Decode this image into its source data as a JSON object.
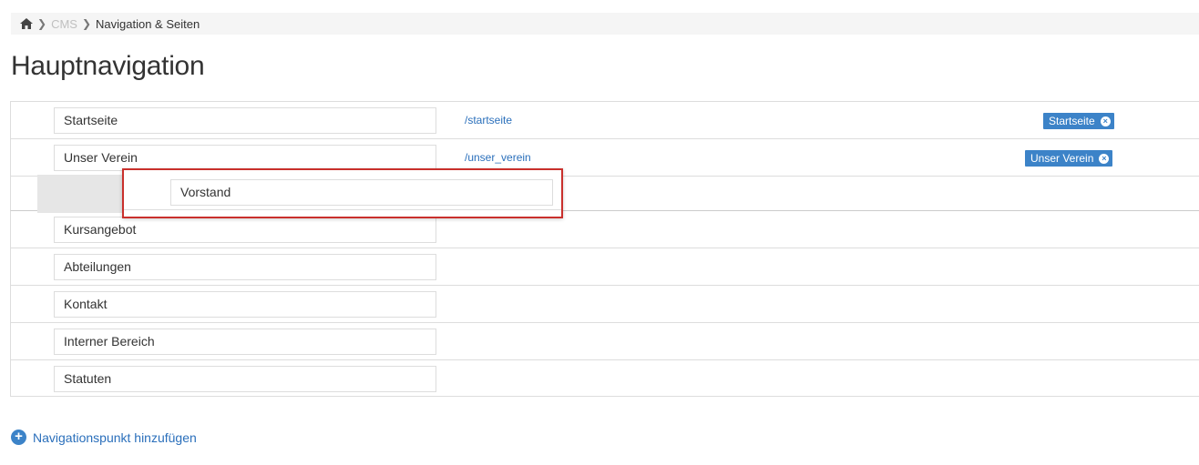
{
  "breadcrumb": {
    "home_icon": "home-icon",
    "items": [
      "CMS",
      "Navigation & Seiten"
    ]
  },
  "page": {
    "title": "Hauptnavigation"
  },
  "nav_items": [
    {
      "name": "Startseite",
      "path": "/startseite",
      "tag": "Startseite"
    },
    {
      "name": "Unser Verein",
      "path": "/unser_verein",
      "tag": "Unser Verein"
    },
    {
      "name": "Kursangebot"
    },
    {
      "name": "Abteilungen"
    },
    {
      "name": "Kontakt"
    },
    {
      "name": "Interner Bereich"
    },
    {
      "name": "Statuten"
    }
  ],
  "dragged_item": {
    "name": "Vorstand"
  },
  "actions": {
    "add_label": "Navigationspunkt hinzufügen"
  },
  "colors": {
    "accent": "#3c83c8",
    "link": "#2a6fbb",
    "drag_border": "#c9302c"
  }
}
